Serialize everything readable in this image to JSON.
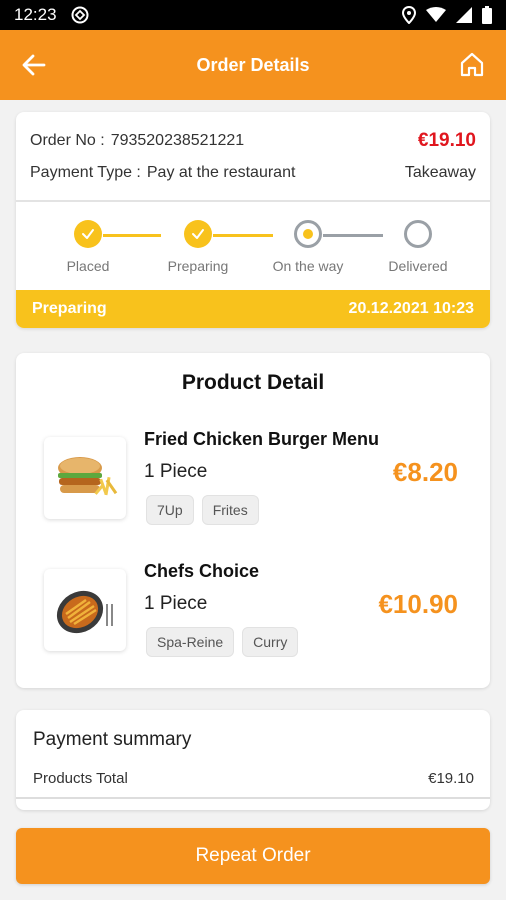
{
  "status_bar": {
    "time": "12:23"
  },
  "header": {
    "title": "Order Details"
  },
  "order": {
    "number_label": "Order No :",
    "number": "793520238521221",
    "total": "€19.10",
    "payment_label": "Payment Type :",
    "payment_value": "Pay at the restaurant",
    "type": "Takeaway",
    "steps": [
      {
        "label": "Placed",
        "state": "done"
      },
      {
        "label": "Preparing",
        "state": "done"
      },
      {
        "label": "On the way",
        "state": "current"
      },
      {
        "label": "Delivered",
        "state": "pending"
      }
    ],
    "status_text": "Preparing",
    "status_datetime": "20.12.2021 10:23"
  },
  "products": {
    "title": "Product Detail",
    "items": [
      {
        "name": "Fried Chicken Burger Menu",
        "qty": "1 Piece",
        "price": "€8.20",
        "tags": [
          "7Up",
          "Frites"
        ],
        "icon": "burger-menu-image"
      },
      {
        "name": "Chefs Choice",
        "qty": "1 Piece",
        "price": "€10.90",
        "tags": [
          "Spa-Reine",
          "Curry"
        ],
        "icon": "fries-plate-image"
      }
    ]
  },
  "summary": {
    "title": "Payment summary",
    "products_total_label": "Products Total",
    "products_total_value": "€19.10"
  },
  "footer": {
    "repeat_label": "Repeat Order"
  },
  "colors": {
    "primary": "#f5921e",
    "yellow": "#f8c21c",
    "price_red": "#e0161e",
    "pending_grey": "#9aa0a6"
  }
}
